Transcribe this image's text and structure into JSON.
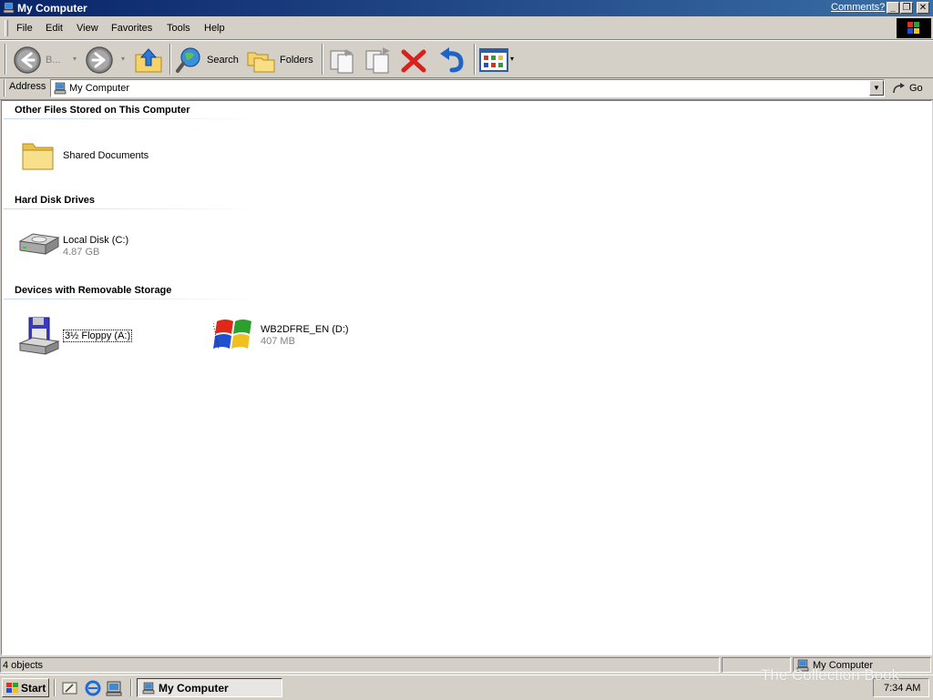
{
  "window": {
    "title": "My Computer",
    "comments_link": "Comments?",
    "caption_buttons": {
      "minimize": "_",
      "restore": "❐",
      "close": "✕"
    }
  },
  "menu": {
    "items": [
      "File",
      "Edit",
      "View",
      "Favorites",
      "Tools",
      "Help"
    ]
  },
  "toolbar": {
    "back_label": "B...",
    "search_label": "Search",
    "folders_label": "Folders"
  },
  "address": {
    "label": "Address",
    "value": "My Computer",
    "go_label": "Go"
  },
  "groups": [
    {
      "header": "Other Files Stored on This Computer",
      "items": [
        {
          "name": "Shared Documents",
          "icon": "folder-icon"
        }
      ]
    },
    {
      "header": "Hard Disk Drives",
      "items": [
        {
          "name": "Local Disk (C:)",
          "detail": "4.87 GB",
          "icon": "hard-disk-icon"
        }
      ]
    },
    {
      "header": "Devices with Removable Storage",
      "items": [
        {
          "name": "3½ Floppy (A:)",
          "icon": "floppy-drive-icon"
        },
        {
          "name": "WB2DFRE_EN (D:)",
          "detail": "407 MB",
          "icon": "cd-drive-icon"
        }
      ]
    }
  ],
  "statusbar": {
    "left": "4 objects",
    "right": "My Computer"
  },
  "taskbar": {
    "start_label": "Start",
    "task_label": "My Computer",
    "clock": "7:34 AM"
  },
  "watermark": "The Collection Book",
  "colors": {
    "titlebar_start": "#0a246a",
    "titlebar_end": "#3a6ea5",
    "window_face": "#d4d0c8"
  }
}
